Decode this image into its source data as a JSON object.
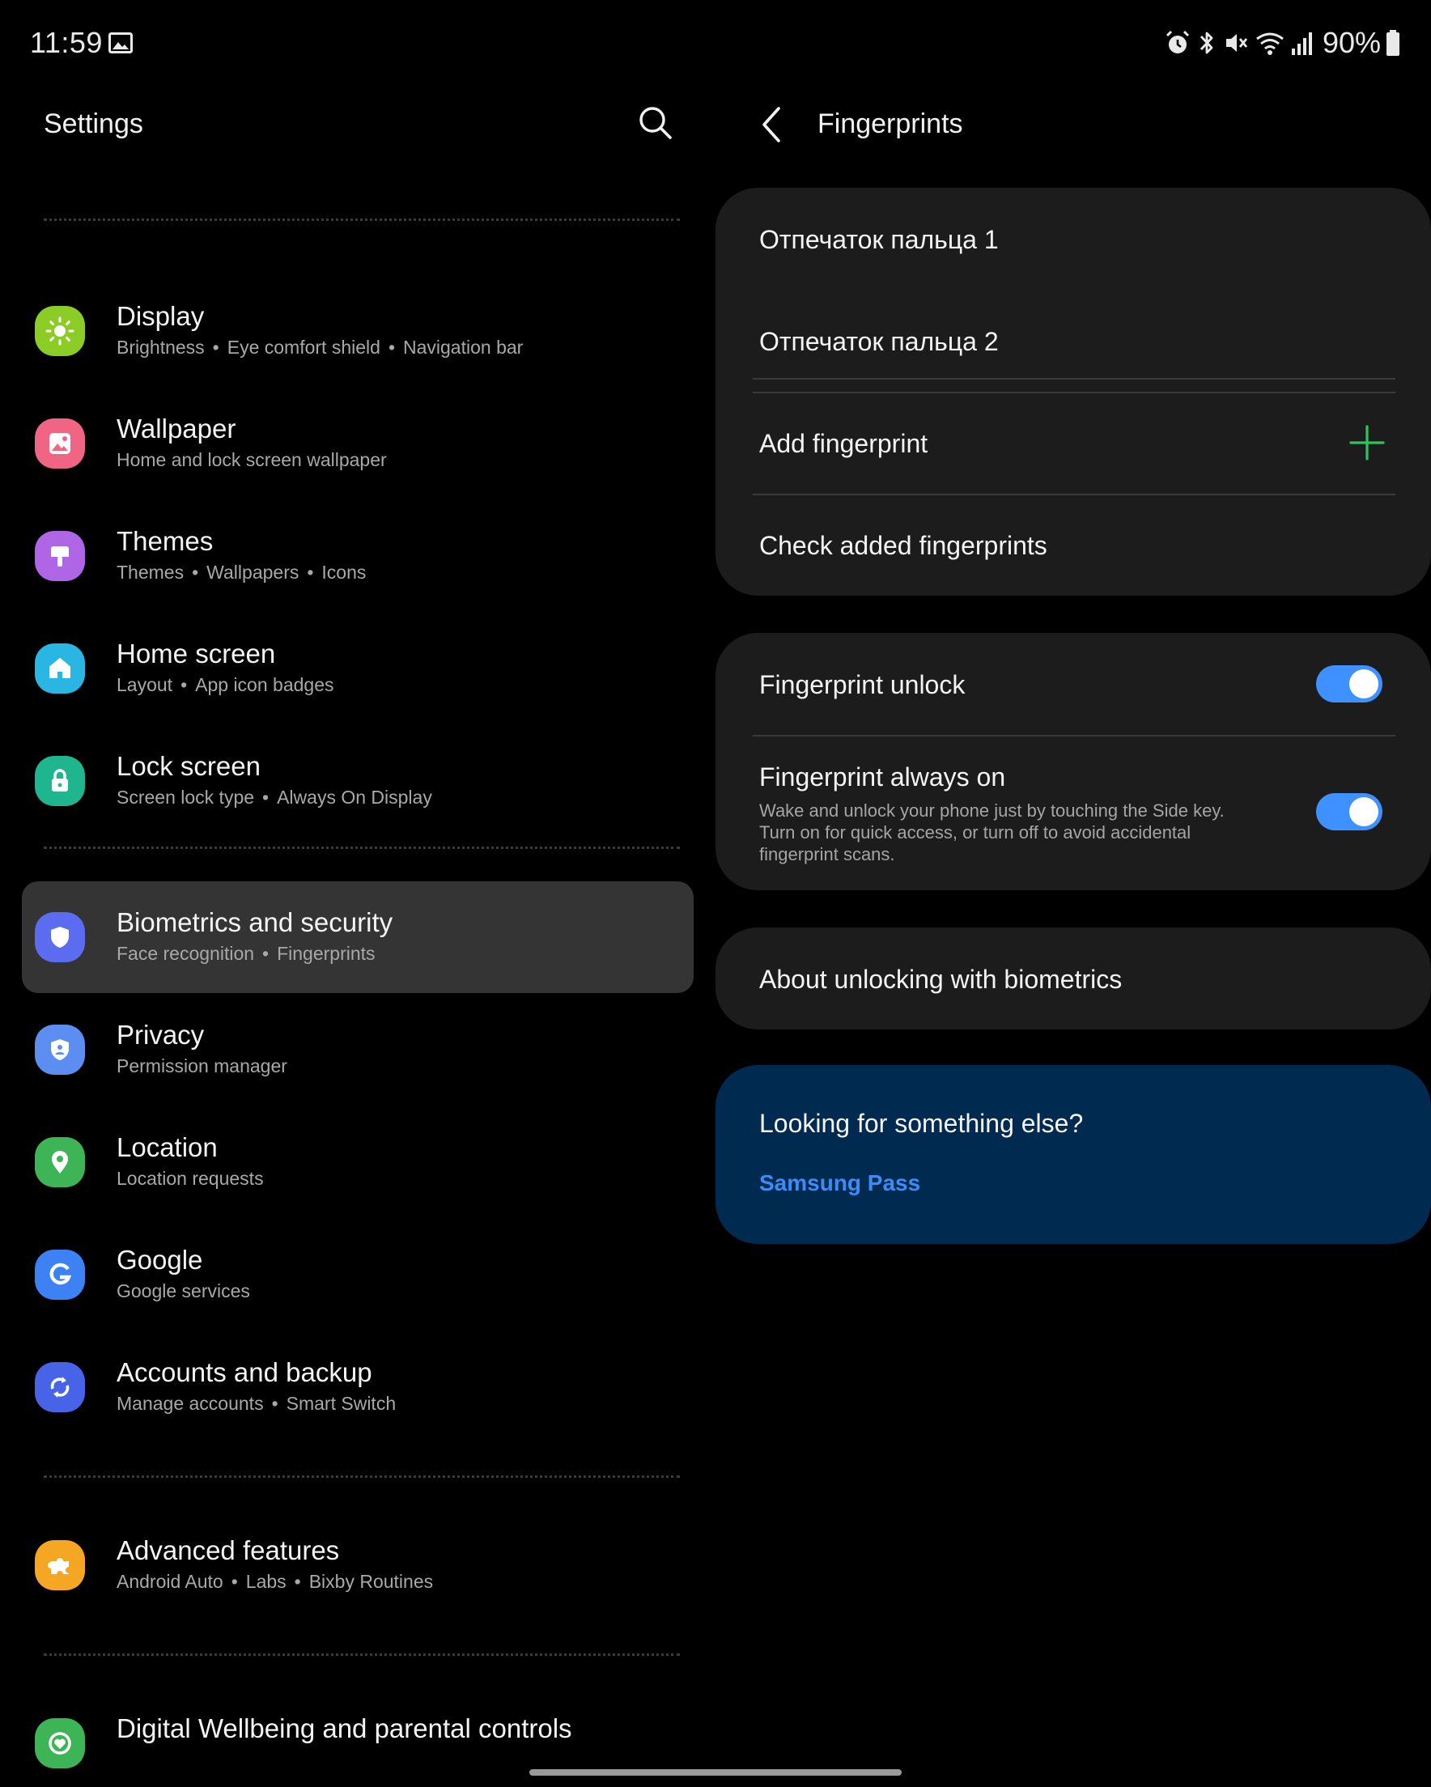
{
  "status_bar": {
    "time": "11:59",
    "battery": "90%",
    "icons": [
      "gallery-icon",
      "alarm-icon",
      "bluetooth-icon",
      "mute-icon",
      "wifi-icon",
      "signal-icon",
      "battery-icon"
    ]
  },
  "left": {
    "title": "Settings",
    "items": [
      {
        "title": "Display",
        "subs": [
          "Brightness",
          "Eye comfort shield",
          "Navigation bar"
        ],
        "color": "#8ccc26",
        "icon": "sun-icon"
      },
      {
        "title": "Wallpaper",
        "subs": [
          "Home and lock screen wallpaper"
        ],
        "color": "#f06484",
        "icon": "image-icon"
      },
      {
        "title": "Themes",
        "subs": [
          "Themes",
          "Wallpapers",
          "Icons"
        ],
        "color": "#b065e6",
        "icon": "brush-icon"
      },
      {
        "title": "Home screen",
        "subs": [
          "Layout",
          "App icon badges"
        ],
        "color": "#29b6e3",
        "icon": "home-icon"
      },
      {
        "title": "Lock screen",
        "subs": [
          "Screen lock type",
          "Always On Display"
        ],
        "color": "#1fb58f",
        "icon": "lock-icon"
      },
      {
        "title": "Biometrics and security",
        "subs": [
          "Face recognition",
          "Fingerprints"
        ],
        "color": "#5b6cf0",
        "icon": "shield-icon"
      },
      {
        "title": "Privacy",
        "subs": [
          "Permission manager"
        ],
        "color": "#5b8ef0",
        "icon": "privacy-shield-icon"
      },
      {
        "title": "Location",
        "subs": [
          "Location requests"
        ],
        "color": "#3db455",
        "icon": "location-pin-icon"
      },
      {
        "title": "Google",
        "subs": [
          "Google services"
        ],
        "color": "#3c82f5",
        "icon": "google-g-icon"
      },
      {
        "title": "Accounts and backup",
        "subs": [
          "Manage accounts",
          "Smart Switch"
        ],
        "color": "#4763e8",
        "icon": "sync-icon"
      },
      {
        "title": "Advanced features",
        "subs": [
          "Android Auto",
          "Labs",
          "Bixby Routines"
        ],
        "color": "#f5a623",
        "icon": "puzzle-icon"
      },
      {
        "title": "Digital Wellbeing and parental controls",
        "subs": [],
        "color": "#3db455",
        "icon": "wellbeing-icon"
      }
    ]
  },
  "right": {
    "title": "Fingerprints",
    "fingerprints": [
      "Отпечаток пальца 1",
      "Отпечаток пальца 2"
    ],
    "add_label": "Add fingerprint",
    "check_label": "Check added fingerprints",
    "unlock_label": "Fingerprint unlock",
    "unlock_on": true,
    "always_on_label": "Fingerprint always on",
    "always_on_desc": "Wake and unlock your phone just by touching the Side key. Turn on for quick access, or turn off to avoid accidental fingerprint scans.",
    "always_on_on": true,
    "about_label": "About unlocking with biometrics",
    "suggest_title": "Looking for something else?",
    "suggest_link": "Samsung Pass",
    "accent": "#3e91ff",
    "plus_color": "#2ec45b"
  }
}
